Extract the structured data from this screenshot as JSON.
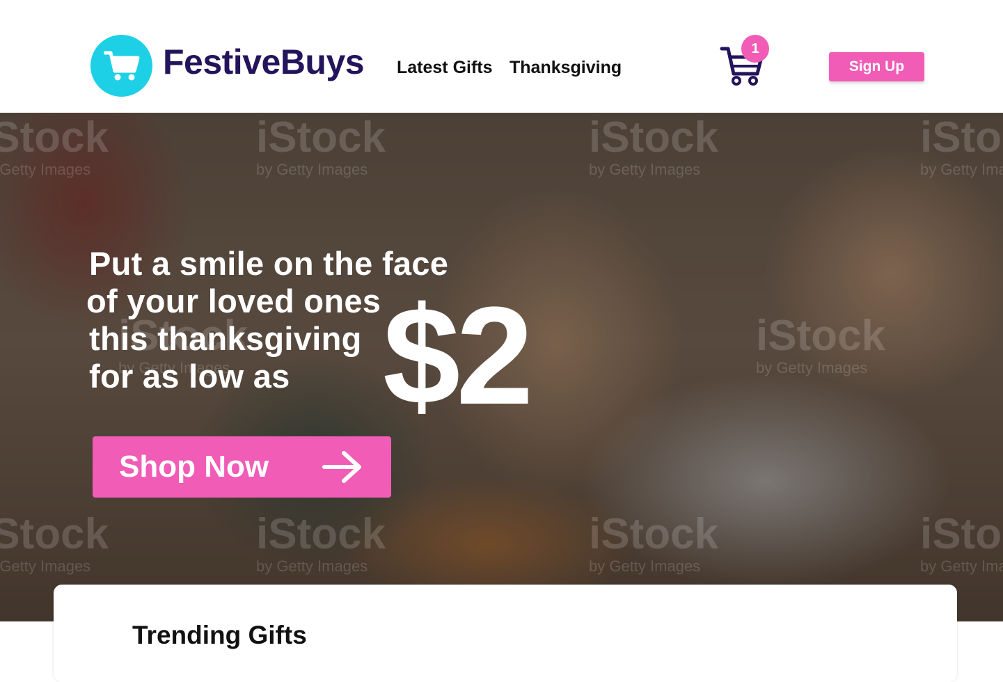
{
  "brand": {
    "name": "FestiveBuys",
    "logo_icon": "shopping-cart-icon",
    "logo_color": "#1ed0e6",
    "text_color": "#23145c"
  },
  "nav": {
    "links": [
      {
        "label": "Latest Gifts"
      },
      {
        "label": "Thanksgiving"
      }
    ]
  },
  "cart": {
    "icon": "shopping-cart-icon",
    "count": "1",
    "badge_color": "#f05cb6"
  },
  "auth": {
    "signup_label": "Sign Up"
  },
  "hero": {
    "lines": [
      "Put a smile on the face",
      "of your loved ones",
      "this thanksgiving",
      "for as low as"
    ],
    "price": "$2",
    "cta_label": "Shop Now",
    "cta_icon": "arrow-right-icon",
    "cta_color": "#f05cb6",
    "watermark": {
      "brand": "iStock",
      "sub": "by Getty Images"
    }
  },
  "trending": {
    "title": "Trending Gifts"
  }
}
